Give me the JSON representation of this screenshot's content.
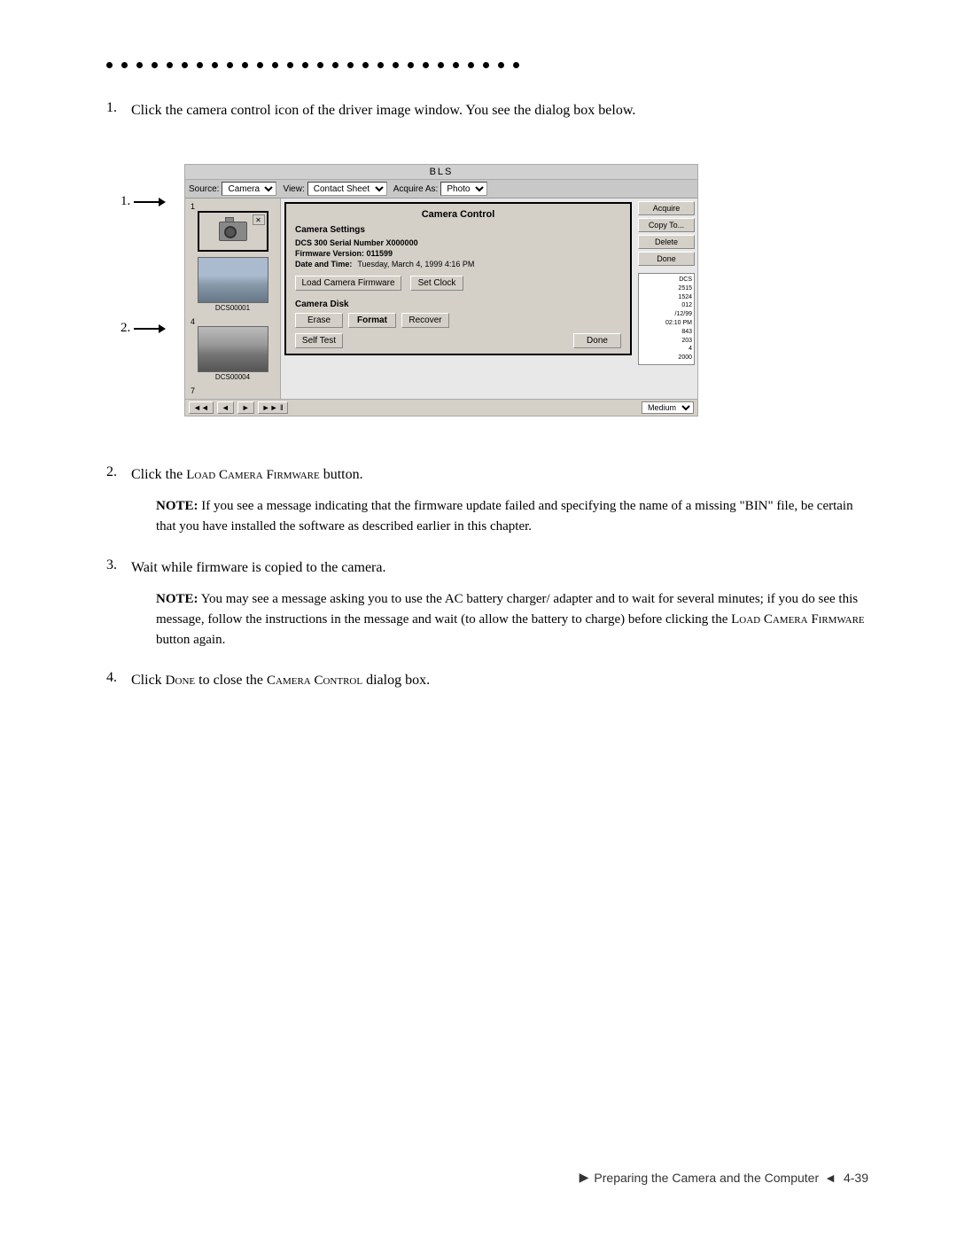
{
  "page": {
    "dots_count": 28
  },
  "steps": [
    {
      "number": "1.",
      "text": "Click the camera control icon of the driver image window. You see the dialog box below."
    },
    {
      "number": "2.",
      "text": "Click the ",
      "text_small_caps": "Load Camera Firmware",
      "text_after": " button."
    },
    {
      "number": "3.",
      "text": "Wait while firmware is copied to the camera."
    },
    {
      "number": "4.",
      "text": "Click ",
      "text_small_caps2": "Done",
      "text_after2": " to close the ",
      "text_small_caps3": "Camera Control",
      "text_after3": " dialog box."
    }
  ],
  "notes": [
    {
      "label": "NOTE:",
      "text": " If you see a message indicating that the firmware update failed and specifying the name of a missing \"BIN\" file, be certain that you have installed the software as described earlier in this chapter."
    },
    {
      "label": "NOTE:",
      "text": " You may see a message asking you to use the AC battery charger/ adapter and to wait for several minutes; if you do see this message, follow the instructions in the message and wait (to allow the battery to charge) before clicking the ",
      "text_small_caps": "Load Camera Firmware",
      "text_after": " button again."
    }
  ],
  "screenshot": {
    "title": "BLS",
    "toolbar": {
      "source_label": "Source:",
      "source_value": "Camera",
      "view_label": "View:",
      "view_value": "Contact Sheet",
      "acquire_label": "Acquire As:",
      "acquire_value": "Photo"
    },
    "right_buttons": [
      "Acquire",
      "Copy To...",
      "Delete",
      "Done"
    ],
    "thumbnail_numbers": [
      "1",
      "4",
      "7"
    ],
    "thumbnail_labels": [
      "DCS00001",
      "DCS00004"
    ],
    "camera_control": {
      "title": "Camera Control",
      "settings_title": "Camera Settings",
      "serial_row": "DCS 300 Serial Number X000000",
      "firmware_row": "Firmware Version: 011599",
      "date_label": "Date and Time:",
      "date_value": "Tuesday, March 4, 1999  4:16 PM",
      "load_firmware_btn": "Load Camera Firmware",
      "set_clock_btn": "Set Clock",
      "disk_title": "Camera Disk",
      "erase_btn": "Erase",
      "format_btn": "Format",
      "recover_btn": "Recover",
      "self_test_btn": "Self Test",
      "done_btn": "Done"
    },
    "right_data": [
      "DCS",
      "2515",
      "1524",
      "012",
      "/12/99",
      "02:10 PM",
      "843",
      "203",
      "4",
      "2000"
    ],
    "bottom": {
      "nav_buttons": [
        "◄◄",
        "◄",
        "►",
        "►► ‖‖"
      ],
      "medium_label": "Medium"
    }
  },
  "footer": {
    "triangle_right": "▶",
    "label": "Preparing the Camera and the Computer",
    "triangle_left": "◄",
    "page": "4-39"
  }
}
